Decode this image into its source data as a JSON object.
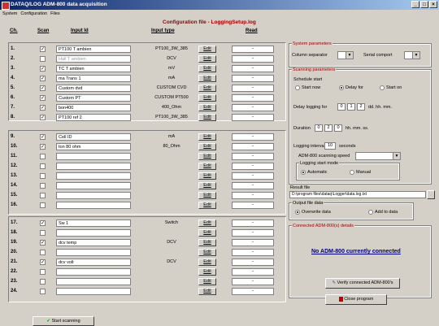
{
  "window": {
    "title": "DATAQ/LOG ADM-800 data acquisition",
    "min": "_",
    "max": "□",
    "close": "×"
  },
  "menu": [
    "System",
    "Configuration",
    "Files"
  ],
  "config_title": "Configuration file - LoggingSetup.log",
  "columns": {
    "ch": "Ch.",
    "scan": "Scan",
    "input_id": "Input Id",
    "input_type": "Input type",
    "read": "Read"
  },
  "edit_label": "Edit",
  "channels_g1": [
    {
      "num": "1.",
      "scan": "✓",
      "name": "PT100 T ambien",
      "type": "PT100_3W_385",
      "read": "-"
    },
    {
      "num": "2.",
      "scan": "",
      "name": "Hall T ambien",
      "type": "DCV",
      "read": "-",
      "gray": true
    },
    {
      "num": "3.",
      "scan": "✓",
      "name": "TC T ambien",
      "type": "mV",
      "read": "-"
    },
    {
      "num": "4.",
      "scan": "✓",
      "name": "ma Trans 1",
      "type": "mA",
      "read": "-"
    },
    {
      "num": "5.",
      "scan": "✓",
      "name": "Custom dvd",
      "type": "CUSTOM CVD",
      "read": "-"
    },
    {
      "num": "6.",
      "scan": "✓",
      "name": "Custom PT",
      "type": "CUSTOM PT500",
      "read": "-"
    },
    {
      "num": "7.",
      "scan": "✓",
      "name": "bon400",
      "type": "400_Ohm",
      "read": "-"
    },
    {
      "num": "8.",
      "scan": "✓",
      "name": "PT100 ref 2",
      "type": "PT100_3W_385",
      "read": "-"
    }
  ],
  "channels_g2": [
    {
      "num": "9.",
      "scan": "✓",
      "name": "Cell ID",
      "type": "mA",
      "read": "-"
    },
    {
      "num": "10.",
      "scan": "✓",
      "name": "ton 80 ohm",
      "type": "80_Ohm",
      "read": "-"
    },
    {
      "num": "11.",
      "scan": "",
      "name": "",
      "type": "",
      "read": "-"
    },
    {
      "num": "12.",
      "scan": "",
      "name": "",
      "type": "",
      "read": "-"
    },
    {
      "num": "13.",
      "scan": "",
      "name": "",
      "type": "",
      "read": "-"
    },
    {
      "num": "14.",
      "scan": "",
      "name": "",
      "type": "",
      "read": "-"
    },
    {
      "num": "15.",
      "scan": "",
      "name": "",
      "type": "",
      "read": "-"
    },
    {
      "num": "16.",
      "scan": "",
      "name": "",
      "type": "",
      "read": "-"
    }
  ],
  "channels_g3": [
    {
      "num": "17.",
      "scan": "✓",
      "name": "Sw 1",
      "type": "Switch",
      "read": "-"
    },
    {
      "num": "18.",
      "scan": "",
      "name": "",
      "type": "",
      "read": "-"
    },
    {
      "num": "19.",
      "scan": "✓",
      "name": "dcv temp",
      "type": "DCV",
      "read": "-"
    },
    {
      "num": "20.",
      "scan": "",
      "name": "",
      "type": "",
      "read": "-"
    },
    {
      "num": "21.",
      "scan": "✓",
      "name": "dcv volt",
      "type": "DCV",
      "read": "-"
    },
    {
      "num": "22.",
      "scan": "",
      "name": "",
      "type": "",
      "read": "-"
    },
    {
      "num": "23.",
      "scan": "",
      "name": "",
      "type": "",
      "read": "-"
    },
    {
      "num": "24.",
      "scan": "",
      "name": "",
      "type": "",
      "read": "-"
    }
  ],
  "system_params": {
    "title": "System parameters",
    "column_separator": "Column separator",
    "serial_port": "Serial comport"
  },
  "scanning": {
    "title": "Scanning parameters",
    "schedule_start": "Schedule start",
    "opt_start_now": "Start now",
    "opt_delay_for": "Delay for",
    "opt_start_on": "Start on",
    "delay_label": "Delay logging for",
    "delay_vals": [
      "0",
      "1",
      "2"
    ],
    "delay_units": "dd. hh. mm.",
    "duration_label": "Duration",
    "duration_vals": [
      "0",
      "2",
      "0"
    ],
    "duration_units": "hh. mm. ss.",
    "interval_label": "Logging interval",
    "interval_val": "10",
    "interval_units": "seconds",
    "speed_label": "ADM-800 scanning speed",
    "mode_title": "Logging start mode",
    "opt_auto": "Automatic",
    "opt_manual": "Manual"
  },
  "results": {
    "label": "Result file",
    "path": "D:\\program files\\dataq\\Logger\\data.log.txt",
    "output_title": "Output file data",
    "opt_overwrite": "Overwrite data",
    "opt_add": "Add to data"
  },
  "connection": {
    "title": "Connected ADM-800(s) details",
    "message": "No ADM-800 currently connected",
    "verify_btn": "Verify connected ADM-800's",
    "close_btn": "Close program"
  },
  "start_btn": "Start scanning"
}
